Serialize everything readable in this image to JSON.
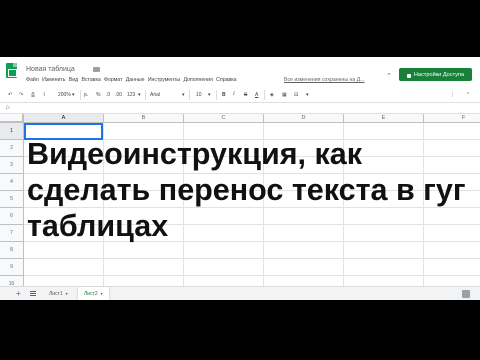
{
  "header": {
    "doc_title": "Новая таблица",
    "menu": [
      "Файл",
      "Изменить",
      "Вид",
      "Вставка",
      "Формат",
      "Данные",
      "Инструменты",
      "Дополнения",
      "Справка"
    ],
    "save_status": "Все изменения сохранены на Д...",
    "share_label": "Настройки Доступа"
  },
  "toolbar": {
    "undo": "↶",
    "redo": "↷",
    "print": "⎙",
    "paint_format": "⌇",
    "zoom": "200%",
    "currency": "р.",
    "percent": "%",
    "decrease_decimals": ".0",
    "increase_decimals": ".00",
    "more_formats": "123",
    "font": "Arial",
    "font_size": "10",
    "bold": "B",
    "italic": "I",
    "strike": "S",
    "text_color": "A",
    "more": "⋮",
    "collapse": "⌃"
  },
  "formula_bar": {
    "fx": "fx"
  },
  "grid": {
    "columns": [
      "A",
      "B",
      "C",
      "D",
      "E",
      "F"
    ],
    "rows": [
      "1",
      "2",
      "3",
      "4",
      "5",
      "6",
      "7",
      "8",
      "9",
      "10"
    ],
    "cell_text": "Видеоинструкция, как сделать перенос текста в гуг таблицах"
  },
  "sheets": {
    "tabs": [
      {
        "label": "Лист1",
        "active": false
      },
      {
        "label": "Лист2",
        "active": true
      }
    ]
  },
  "colors": {
    "share_button": "#188038",
    "selection": "#1a73e8",
    "logo": "#0f9d58"
  }
}
